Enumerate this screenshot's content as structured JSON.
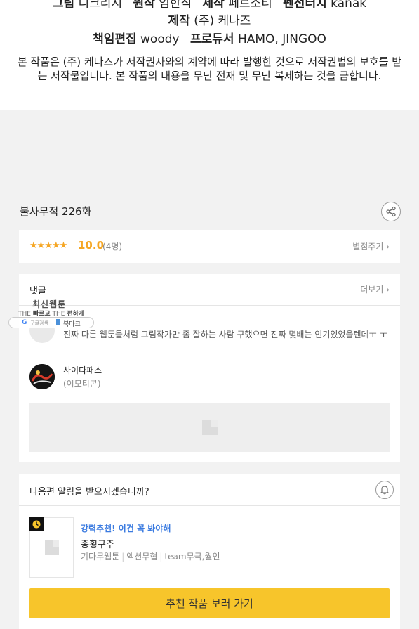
{
  "credits": {
    "line1": {
      "drawing_label": "그림",
      "drawing_value": "디크리시",
      "original_label": "원작",
      "original_value": "임한직",
      "adapt_label": "제작",
      "adapt_value": "페르소티",
      "lineart_label": "펜선터치",
      "lineart_value": "kanak"
    },
    "line2": {
      "production_label": "제작",
      "production_value": "(주) 케나즈"
    },
    "line3": {
      "editor_label": "책임편집",
      "editor_value": "woody",
      "producer_label": "프로듀서",
      "producer_value": "HAMO, JINGOO"
    },
    "copyright": "본 작품은 (주) 케나즈가 저작권자와의 계약에 따라 발행한 것으로 저작권법의 보호를 받는 저작물입니다. 본 작품의 내용을 무단 전재 및 무단 복제하는 것을 금합니다."
  },
  "episode": {
    "title": "불사무적 226화"
  },
  "rating": {
    "stars": "★★★★★",
    "score": "10.0",
    "count": "(4명)",
    "rate_link": "별점주기 ›"
  },
  "comments": {
    "header": "댓글",
    "more_link": "더보기 ›",
    "items": [
      {
        "text": "진짜 다른 웹툰들처럼 그림작가만 좀 잘하는 사람 구했으면 진짜 몇배는 인기있었을텐데ㅜ-ㅜ"
      },
      {
        "name": "사이다패스",
        "text": "(이모티콘)"
      }
    ]
  },
  "overlay": {
    "title": "최신웹툰",
    "sub_prefix": "THE ",
    "sub_bold1": "빠르고",
    "sub_mid": " THE ",
    "sub_bold2": "편하게",
    "google_g": "G",
    "search_label": "구글검색",
    "bookmark_label": "북마크"
  },
  "notification": {
    "question": "다음편 알림을 받으시겠습니까?",
    "recommend": {
      "tag": "강력추천! 이건 꼭 봐야해",
      "title": "종횡구주",
      "genre": "기다무웹툰",
      "category": "액션무협",
      "author": "team무극,월인"
    },
    "cta": "추천 작품 보러 가기"
  },
  "colors": {
    "accent": "#f7c52b",
    "star": "#f5a623",
    "link": "#3b7be0"
  }
}
